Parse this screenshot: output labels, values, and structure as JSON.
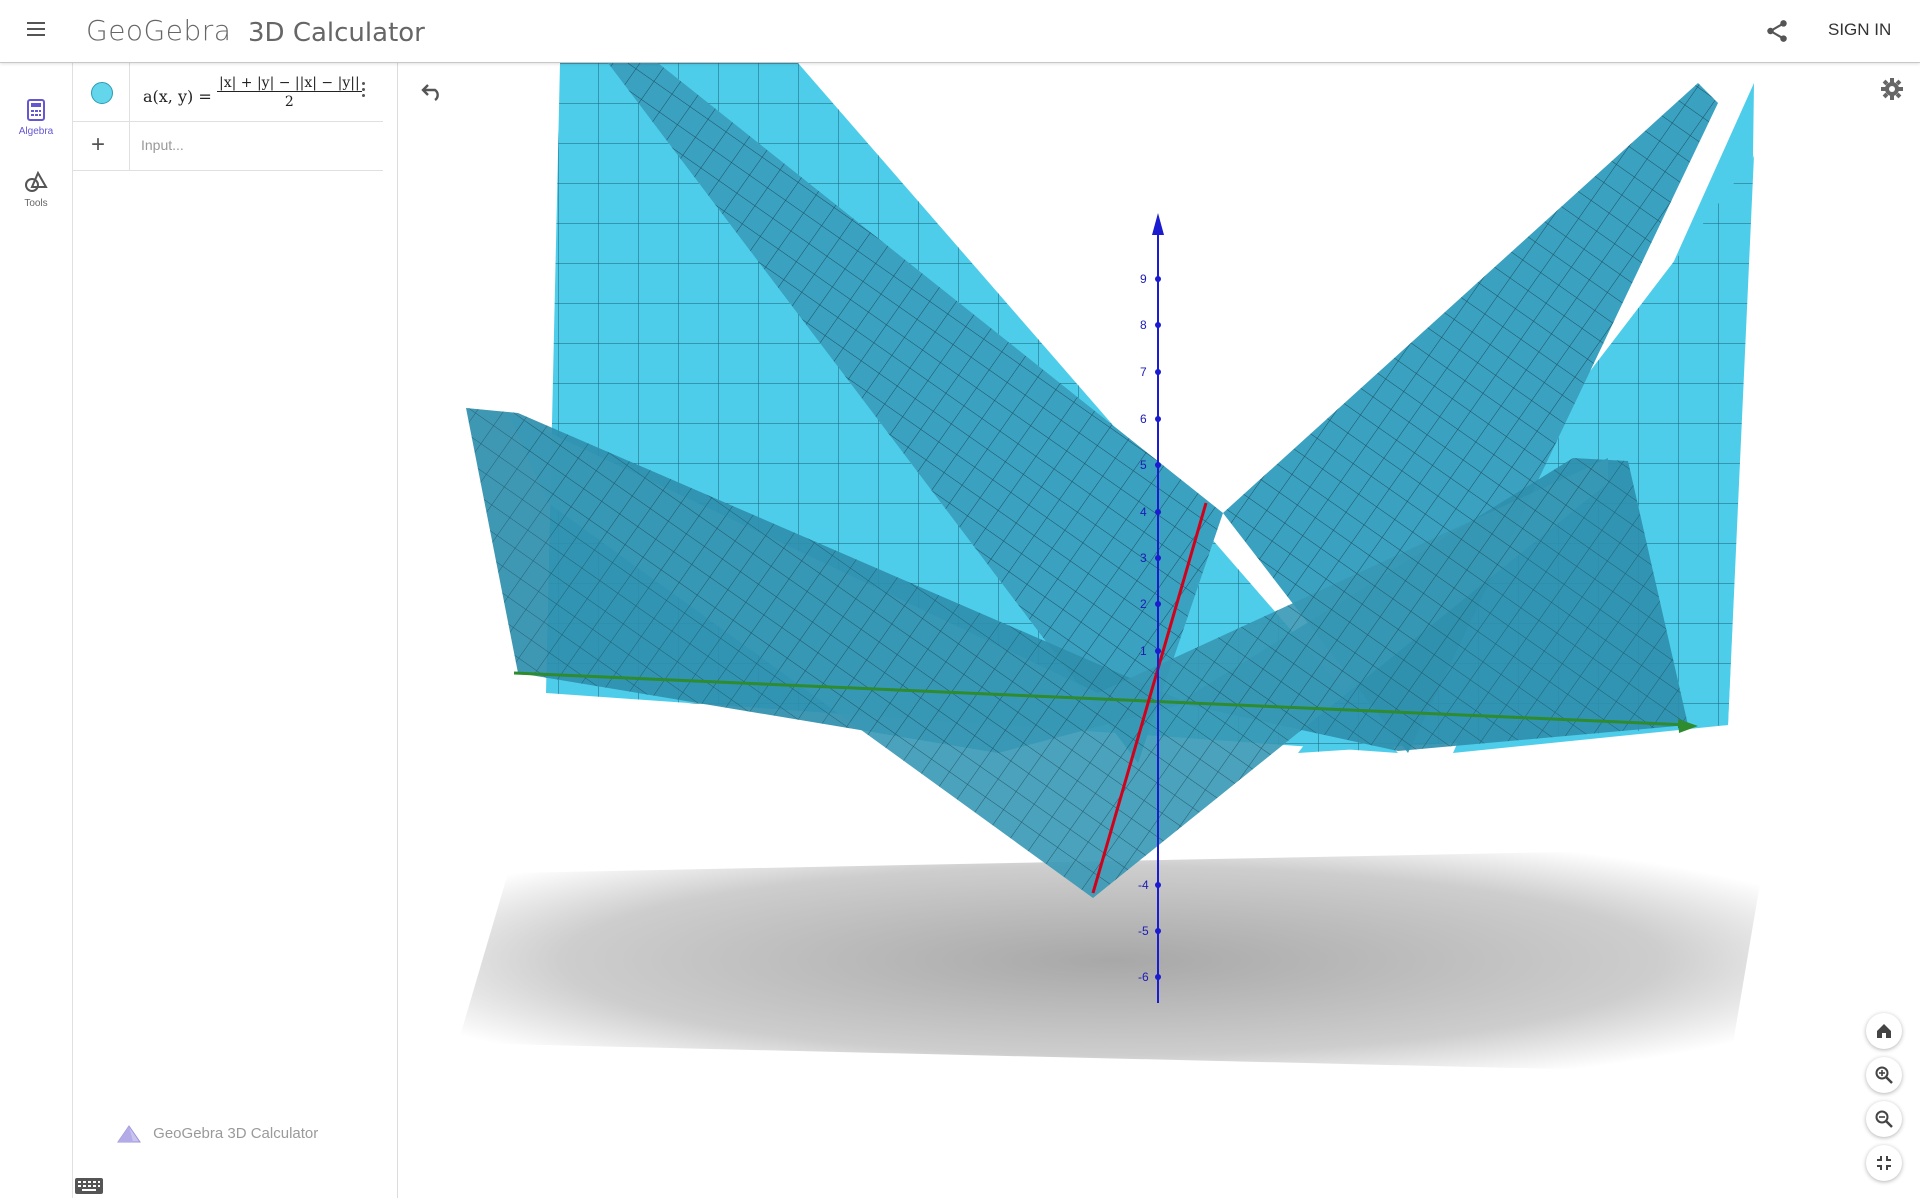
{
  "header": {
    "logo": "GeoGebra",
    "title": "3D Calculator",
    "sign_in": "SIGN IN"
  },
  "rail": {
    "algebra_label": "Algebra",
    "tools_label": "Tools"
  },
  "algebra_view": {
    "function_name": "a(x, y)",
    "equals": "=",
    "numerator": "|x| + |y| − ||x| − |y||",
    "denominator": "2",
    "input_placeholder": "Input..."
  },
  "footer": {
    "brand": "GeoGebra 3D Calculator"
  },
  "graphics": {
    "surface_color": "#4ecdea",
    "surface_dark": "#2f8fac",
    "x_axis_color": "#d0021b",
    "y_axis_color": "#2e8b2e",
    "z_axis_color": "#1b1bd0",
    "z_ticks": [
      "9",
      "8",
      "7",
      "6",
      "5",
      "4",
      "3",
      "2",
      "1",
      "-4",
      "-5",
      "-6"
    ]
  },
  "controls": {
    "home": "home-icon",
    "zoom_in": "zoom-in-icon",
    "zoom_out": "zoom-out-icon",
    "fullscreen": "exit-fullscreen-icon"
  }
}
